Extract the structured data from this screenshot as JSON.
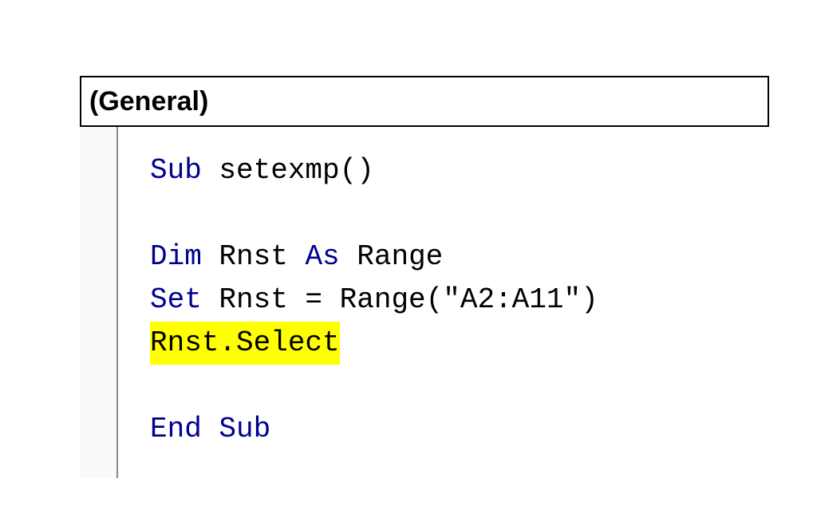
{
  "dropdown": {
    "label": "(General)"
  },
  "code": {
    "line1_kw": "Sub",
    "line1_name": " setexmp()",
    "line2_kw1": "Dim",
    "line2_mid": " Rnst ",
    "line2_kw2": "As",
    "line2_type": " Range",
    "line3_kw": "Set",
    "line3_mid": " Rnst = Range(",
    "line3_str": "\"A2:A11\"",
    "line3_end": ")",
    "line4_highlight": "Rnst.Select",
    "line5_kw": "End Sub"
  }
}
